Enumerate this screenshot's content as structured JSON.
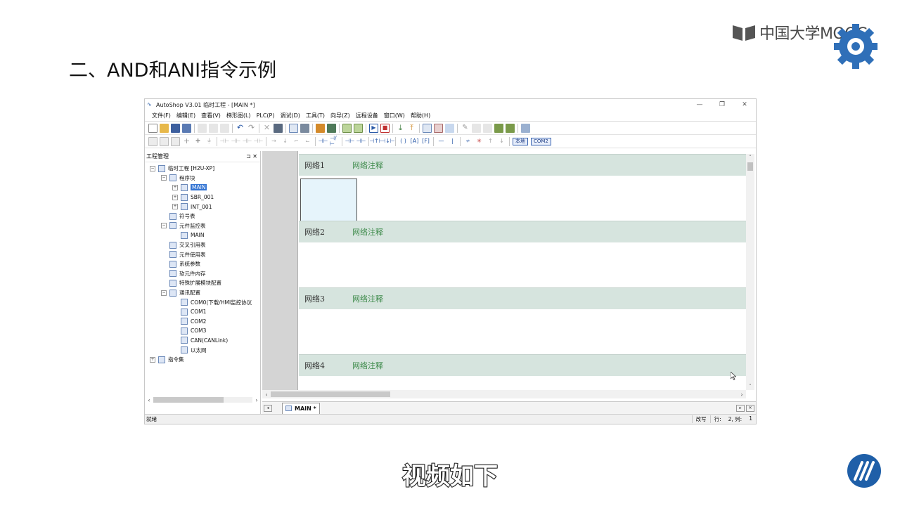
{
  "slide": {
    "title": "二、AND和ANI指令示例",
    "brand": "中国大学MOOC",
    "subtitle": "视频如下"
  },
  "window": {
    "title": "AutoShop V3.01  临时工程 - [MAIN *]",
    "controls": [
      "—",
      "❐",
      "✕"
    ]
  },
  "menu": [
    "文件(F)",
    "编辑(E)",
    "查看(V)",
    "梯形图(L)",
    "PLC(P)",
    "调试(D)",
    "工具(T)",
    "向导(Z)",
    "远程设备",
    "窗口(W)",
    "帮助(H)"
  ],
  "toolbar2": {
    "local_label": "本地",
    "com_label": "COM2"
  },
  "project": {
    "header": "工程管理",
    "pin": "⊐ ✕",
    "tree": [
      {
        "label": "临时工程 [H2U-XP]",
        "level": 0,
        "exp": "−"
      },
      {
        "label": "程序块",
        "level": 1,
        "exp": "−"
      },
      {
        "label": "MAIN",
        "level": 2,
        "exp": "+",
        "selected": true
      },
      {
        "label": "SBR_001",
        "level": 2,
        "exp": "+"
      },
      {
        "label": "INT_001",
        "level": 2,
        "exp": "+"
      },
      {
        "label": "符号表",
        "level": 1,
        "exp": ""
      },
      {
        "label": "元件监控表",
        "level": 1,
        "exp": "−"
      },
      {
        "label": "MAIN",
        "level": 2,
        "exp": ""
      },
      {
        "label": "交叉引用表",
        "level": 1,
        "exp": ""
      },
      {
        "label": "元件使用表",
        "level": 1,
        "exp": ""
      },
      {
        "label": "系统参数",
        "level": 1,
        "exp": ""
      },
      {
        "label": "软元件内存",
        "level": 1,
        "exp": ""
      },
      {
        "label": "特殊扩展模块配置",
        "level": 1,
        "exp": ""
      },
      {
        "label": "通讯配置",
        "level": 1,
        "exp": "−"
      },
      {
        "label": "COM0(下载/HMI监控协议",
        "level": 2,
        "exp": ""
      },
      {
        "label": "COM1",
        "level": 2,
        "exp": ""
      },
      {
        "label": "COM2",
        "level": 2,
        "exp": ""
      },
      {
        "label": "COM3",
        "level": 2,
        "exp": ""
      },
      {
        "label": "CAN(CANLink)",
        "level": 2,
        "exp": ""
      },
      {
        "label": "以太网",
        "level": 2,
        "exp": ""
      },
      {
        "label": "指令集",
        "level": 0,
        "exp": "+"
      }
    ]
  },
  "networks": [
    {
      "name": "网络1",
      "comment": "网络注释"
    },
    {
      "name": "网络2",
      "comment": "网络注释"
    },
    {
      "name": "网络3",
      "comment": "网络注释"
    },
    {
      "name": "网络4",
      "comment": "网络注释"
    }
  ],
  "tab": {
    "label": "MAIN *"
  },
  "status": {
    "left": "就绪",
    "mode": "改写",
    "row_label": "行:",
    "row_value": "2, 列:",
    "col_value": "1"
  }
}
